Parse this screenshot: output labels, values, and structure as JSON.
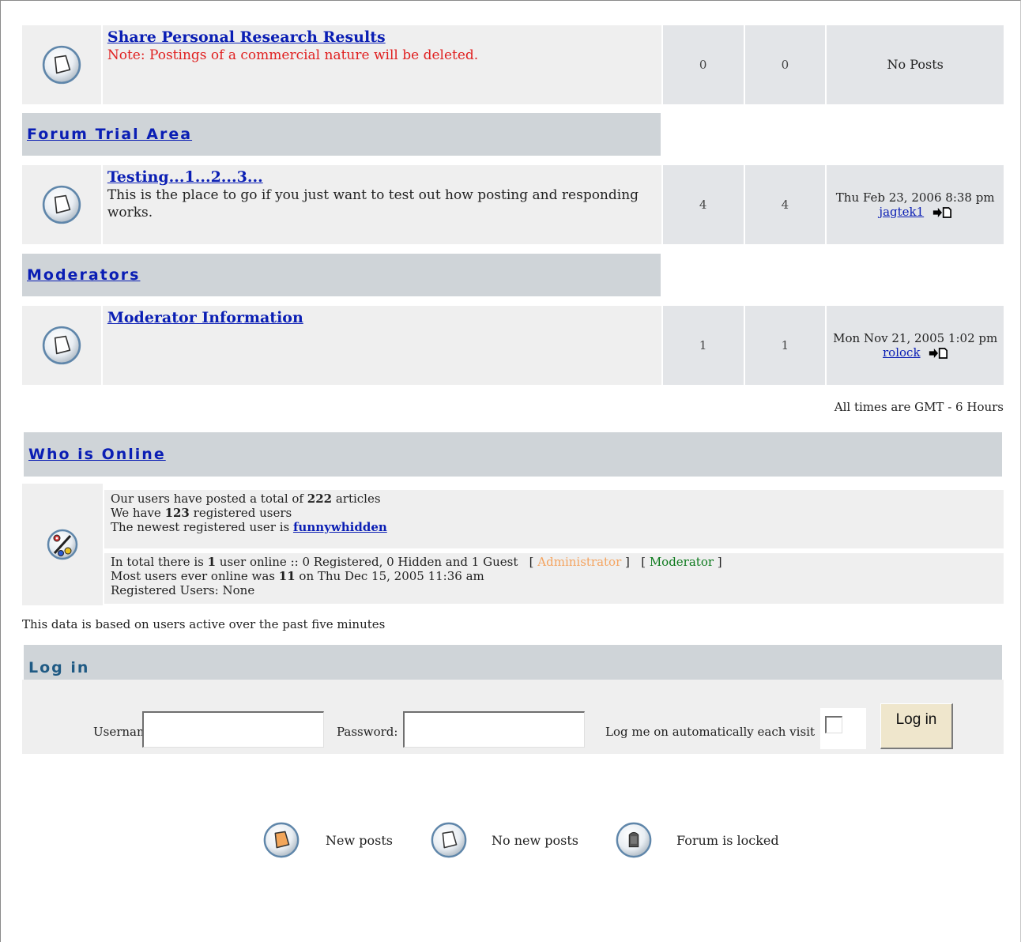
{
  "forums": [
    {
      "title": "Share Personal Research Results",
      "description": "Note: Postings of a commercial nature will be deleted.",
      "topics": "0",
      "posts": "0",
      "last_post": "No Posts",
      "last_user": ""
    },
    {
      "category": "Forum Trial Area",
      "title": "Testing...1...2...3...",
      "description": "This is the place to go if you just want to test out how posting and responding works.",
      "topics": "4",
      "posts": "4",
      "last_post": "Thu Feb 23, 2006 8:38 pm",
      "last_user": "jagtek1"
    },
    {
      "category": "Moderators",
      "title": "Moderator Information",
      "description": "",
      "topics": "1",
      "posts": "1",
      "last_post": "Mon Nov 21, 2005 1:02 pm",
      "last_user": "rolock"
    }
  ],
  "timezone_note": "All times are GMT - 6 Hours",
  "who_is_online": {
    "title": "Who is Online",
    "articles_prefix": "Our users have posted a total of ",
    "articles_count": "222",
    "articles_suffix": " articles",
    "users_prefix": "We have ",
    "users_count": "123",
    "users_suffix": " registered users",
    "newest_prefix": "The newest registered user is ",
    "newest_user": "funnywhidden",
    "online_prefix": "In total there is ",
    "online_count": "1",
    "online_suffix": " user online :: 0 Registered, 0 Hidden and 1 Guest",
    "legend_admin": "Administrator",
    "legend_moderator": "Moderator",
    "most_prefix": "Most users ever online was ",
    "most_count": "11",
    "most_suffix": " on Thu Dec 15, 2005 11:36 am",
    "registered_users": "Registered Users: None"
  },
  "activity_note": "This data is based on users active over the past five minutes",
  "login": {
    "title": "Log in",
    "username_label": "Username:",
    "username_value": "",
    "password_label": "Password:",
    "password_value": "",
    "auto_label": "Log me on automatically each visit",
    "auto_checked": false,
    "button_label": "Log in"
  },
  "legend": {
    "new_posts": "New posts",
    "no_new_posts": "No new posts",
    "locked": "Forum is locked"
  },
  "colors": {
    "link": "#0a1eb4",
    "note_red": "#e02020",
    "admin": "#f4a460",
    "moderator": "#0e7a1e",
    "bar": "#cfd4d8",
    "cell": "#efefef",
    "stat_cell": "#e3e5e8"
  },
  "icons": {
    "folder": "folder-icon",
    "folder_new": "folder-new-icon",
    "folder_locked": "folder-locked-icon",
    "who_online": "who-online-icon",
    "last_post": "last-post-icon"
  }
}
